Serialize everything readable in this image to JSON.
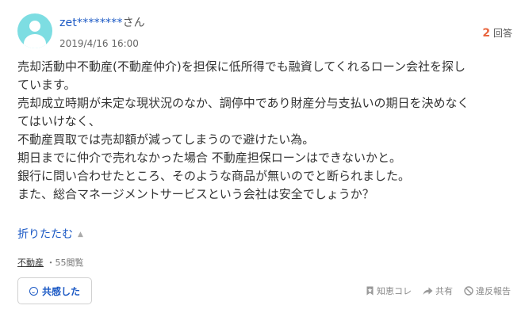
{
  "user": {
    "name": "zet********",
    "honorific": "さん",
    "date": "2019/4/16 16:00"
  },
  "answers": {
    "count": "2",
    "label": "回答"
  },
  "question": {
    "lines": [
      "売却活動中不動産(不動産仲介)を担保に低所得でも融資してくれるローン会社を探し",
      "ています。",
      "売却成立時期が未定な現状況のなか、調停中であり財産分与支払いの期日を決めなく",
      "てはいけなく、",
      "不動産買取では売却額が減ってしまうので避けたい為。",
      "期日までに仲介で売れなかった場合 不動産担保ローンはできないかと。",
      "銀行に問い合わせたところ、そのような商品が無いのでと断られました。",
      "また、総合マネージメントサービスという会社は安全でしょうか？"
    ]
  },
  "collapse_label": "折りたたむ",
  "meta": {
    "category": "不動産",
    "views": "・55閲覧"
  },
  "buttons": {
    "empathy": "共感した",
    "save": "知恵コレ",
    "share": "共有",
    "report": "違反報告"
  },
  "colors": {
    "accent": "#1a58c4",
    "count": "#e9663f",
    "avatar": "#7ddde2"
  }
}
